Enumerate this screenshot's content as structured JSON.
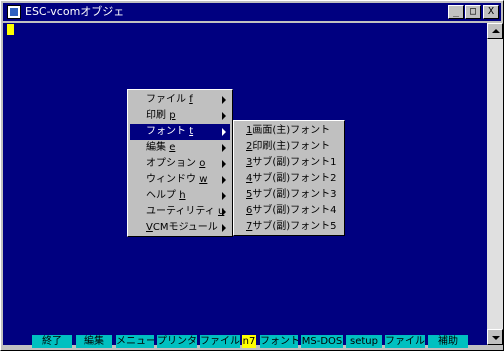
{
  "window": {
    "title": "ESC-vcomオブジェ",
    "minimize_glyph": "_",
    "maximize_glyph": "□",
    "close_glyph": "X"
  },
  "menu": {
    "items": [
      {
        "label": "ファイル",
        "accel": "f",
        "selected": false
      },
      {
        "label": "印刷",
        "accel": "p",
        "selected": false
      },
      {
        "label": "フォント",
        "accel": "t",
        "selected": true
      },
      {
        "label": "編集",
        "accel": "e",
        "selected": false
      },
      {
        "label": "オプション",
        "accel": "o",
        "selected": false
      },
      {
        "label": "ウィンドウ",
        "accel": "w",
        "selected": false
      },
      {
        "label": "ヘルプ",
        "accel": "h",
        "selected": false
      },
      {
        "label": "ユーティリティ",
        "accel": "u",
        "selected": false
      },
      {
        "label": "CMモジュール",
        "accel": "V",
        "selected": false
      }
    ]
  },
  "submenu": {
    "items": [
      {
        "num": "1",
        "label": "画面(主)フォント"
      },
      {
        "num": "2",
        "label": "印刷(主)フォント"
      },
      {
        "num": "3",
        "label": "サブ(副)フォント1"
      },
      {
        "num": "4",
        "label": "サブ(副)フォント2"
      },
      {
        "num": "5",
        "label": "サブ(副)フォント3"
      },
      {
        "num": "6",
        "label": "サブ(副)フォント4"
      },
      {
        "num": "7",
        "label": "サブ(副)フォント5"
      }
    ]
  },
  "function_keys": [
    {
      "label": "終了",
      "highlight": false
    },
    {
      "label": "編集",
      "highlight": false
    },
    {
      "label": "メニュー",
      "highlight": false
    },
    {
      "label": "プリンター",
      "highlight": false
    },
    {
      "label": "ファイル受",
      "highlight": false
    },
    {
      "label": "n7",
      "highlight": true
    },
    {
      "label": "フォント",
      "highlight": false
    },
    {
      "label": "MS-DOS",
      "highlight": false
    },
    {
      "label": "setup",
      "highlight": false
    },
    {
      "label": "ファイル送",
      "highlight": false
    },
    {
      "label": "補助",
      "highlight": false
    }
  ],
  "colors": {
    "client_background": "#000080",
    "titlebar": "#000080",
    "function_key": "#00c0c0",
    "function_key_highlight": "#ffff00",
    "cursor": "#ffff00",
    "menu_selection": "#000080"
  }
}
